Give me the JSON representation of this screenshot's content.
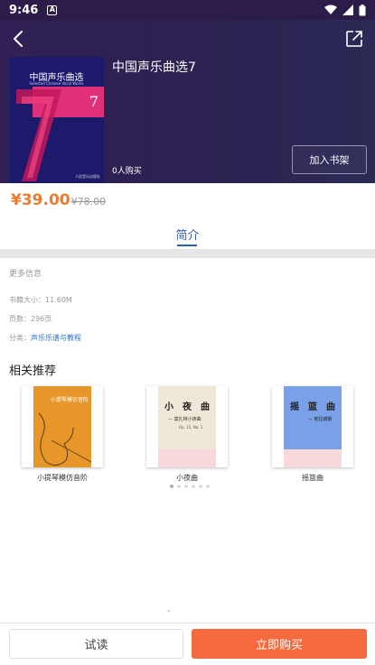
{
  "status": {
    "time": "9:46",
    "badge": "A"
  },
  "book": {
    "title": "中国声乐曲选7",
    "buyers": "0人购买",
    "add_shelf": "加入书架",
    "price": "¥39.00",
    "original_price": "¥78.00",
    "cover": {
      "title": "中国声乐曲选",
      "subtitle": "Selected Chinese Vocal Works",
      "number": "7",
      "publisher": "人民音乐出版社"
    }
  },
  "tabs": {
    "intro": "简介"
  },
  "more_info": {
    "heading": "更多信息",
    "size_label": "书籍大小：",
    "size_value": "11.60M",
    "pages_label": "页数：",
    "pages_value": "296页",
    "category_label": "分类：",
    "category_value": "声乐乐谱与教程"
  },
  "recommend": {
    "heading": "相关推荐",
    "items": [
      {
        "name": "小提琴模仿音阶",
        "cover_title": "小提琴模仿音阶"
      },
      {
        "name": "小夜曲",
        "cover_title": "小　夜　曲",
        "cover_sub": "— 莫扎特小夜曲",
        "cover_op": "Op. 15, No. 1"
      },
      {
        "name": "摇篮曲",
        "cover_title": "摇　篮　曲",
        "cover_sub": "— 勃拉姆斯"
      }
    ]
  },
  "actions": {
    "try": "试读",
    "buy": "立即购买"
  },
  "colors": {
    "accent": "#f56a3e",
    "link": "#2f6fd0",
    "header": "#2c2150"
  }
}
